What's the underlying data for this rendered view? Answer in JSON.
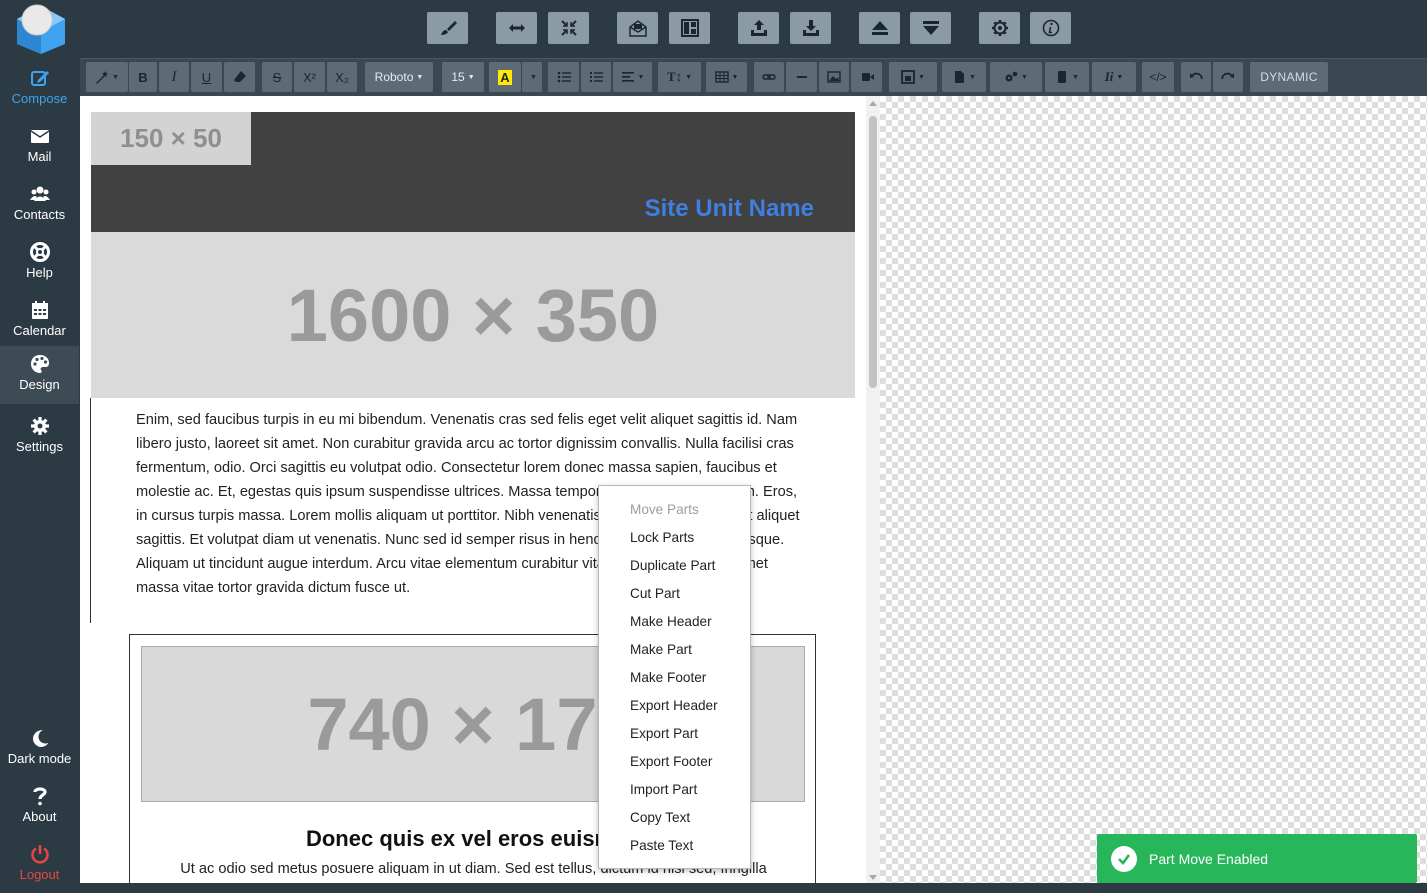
{
  "sidebar": {
    "items": [
      {
        "label": "Compose",
        "icon": "compose-icon"
      },
      {
        "label": "Mail",
        "icon": "mail-icon"
      },
      {
        "label": "Contacts",
        "icon": "contacts-icon"
      },
      {
        "label": "Help",
        "icon": "lifebuoy-icon"
      },
      {
        "label": "Calendar",
        "icon": "calendar-icon"
      },
      {
        "label": "Design",
        "icon": "palette-icon"
      },
      {
        "label": "Settings",
        "icon": "gear-icon"
      }
    ],
    "bottom": [
      {
        "label": "Dark mode",
        "icon": "moon-icon"
      },
      {
        "label": "About",
        "icon": "question-icon"
      },
      {
        "label": "Logout",
        "icon": "power-icon"
      }
    ]
  },
  "format_bar": {
    "font_family": "Roboto",
    "font_size": "15",
    "dynamic_label": "DYNAMIC"
  },
  "email": {
    "logo_placeholder": "150 × 50",
    "site_unit_name": "Site Unit Name",
    "banner_placeholder": "1600 × 350",
    "body_text": "Enim, sed faucibus turpis in eu mi bibendum. Venenatis cras sed felis eget velit aliquet sagittis id. Nam libero justo, laoreet sit amet. Non curabitur gravida arcu ac tortor dignissim convallis. Nulla facilisi cras fermentum, odio. Orci sagittis eu volutpat odio. Consectetur lorem donec massa sapien, faucibus et molestie ac. Et, egestas quis ipsum suspendisse ultrices. Massa tempor nec feugiat nisl pretium. Eros, in cursus turpis massa. Lorem mollis aliquam ut porttitor. Nibh venenatis cras sed felis eget velit aliquet sagittis. Et volutpat diam ut venenatis. Nunc sed id semper risus in hendrerit gravida rutrum quisque. Aliquam ut tincidunt augue interdum. Arcu vitae elementum curabitur vitae nunc sed velit. Sit amet massa vitae tortor gravida dictum fusce ut.",
    "card_placeholder": "740 × 175",
    "card_title": "Donec quis ex vel eros euismod",
    "card_text": "Ut ac odio sed metus posuere aliquam in ut diam. Sed est tellus, dictum id nisl sed, fringilla"
  },
  "context_menu": {
    "items": [
      {
        "label": "Move Parts",
        "disabled": true
      },
      {
        "label": "Lock Parts"
      },
      {
        "label": "Duplicate Part"
      },
      {
        "label": "Cut Part"
      },
      {
        "label": "Make Header"
      },
      {
        "label": "Make Part"
      },
      {
        "label": "Make Footer"
      },
      {
        "label": "Export Header"
      },
      {
        "label": "Export Part"
      },
      {
        "label": "Export Footer"
      },
      {
        "label": "Import Part"
      },
      {
        "label": "Copy Text"
      },
      {
        "label": "Paste Text"
      }
    ]
  },
  "toast": {
    "message": "Part Move Enabled",
    "color": "#27b65a"
  },
  "colors": {
    "accent": "#3fa3f0",
    "logout": "#e8473f",
    "site_unit": "#3f7fe0"
  }
}
